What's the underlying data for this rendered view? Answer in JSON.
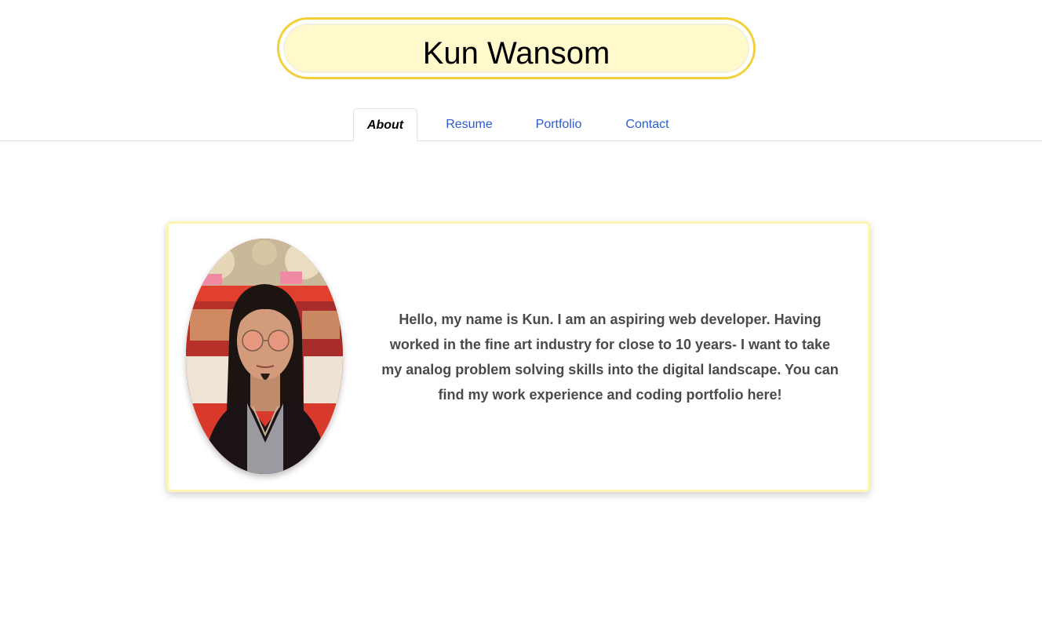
{
  "header": {
    "title": "Kun Wansom",
    "pill_border_color": "#f2d03a",
    "pill_fill_color": "#fff9cc"
  },
  "nav": {
    "tabs": [
      {
        "label": "About",
        "active": true
      },
      {
        "label": "Resume",
        "active": false
      },
      {
        "label": "Portfolio",
        "active": false
      },
      {
        "label": "Contact",
        "active": false
      }
    ],
    "link_color": "#2d5ccf"
  },
  "about_card": {
    "avatar_icon": "profile-photo",
    "bio": "Hello, my name is Kun. I am an aspiring web developer. Having worked in the fine art industry for close to 10 years- I want to take my analog problem solving skills into the digital landscape. You can find my work experience and coding portfolio here!",
    "border_color": "#fdf6b2"
  }
}
